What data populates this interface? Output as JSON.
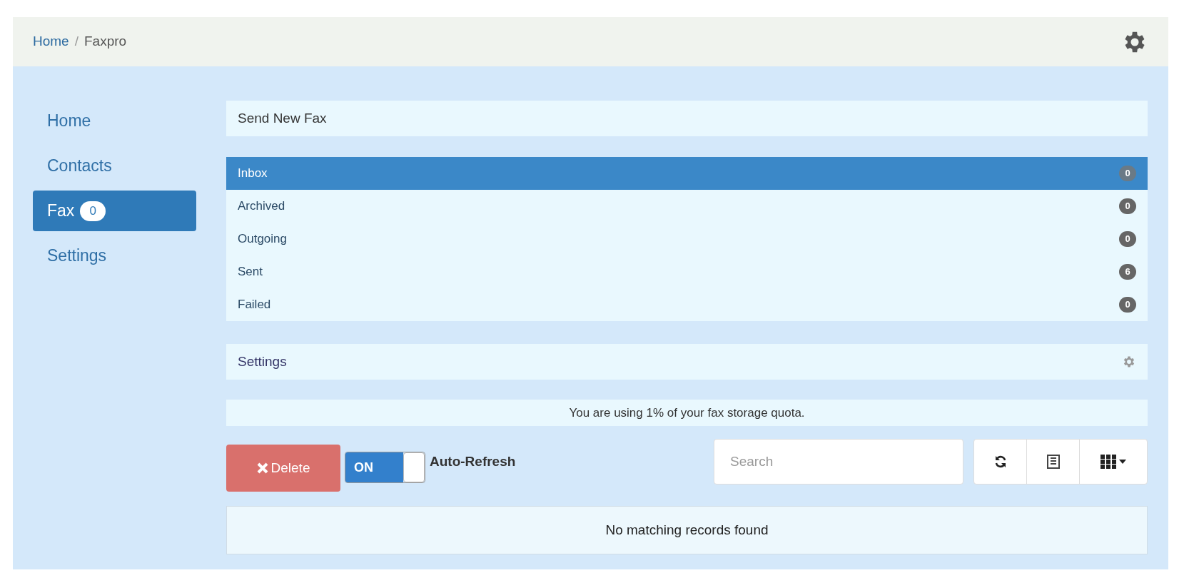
{
  "breadcrumb": {
    "items": [
      "Home",
      "Faxpro"
    ],
    "separator": "/"
  },
  "sidebar": {
    "items": [
      {
        "label": "Home",
        "selected": false
      },
      {
        "label": "Contacts",
        "selected": false
      },
      {
        "label": "Fax",
        "badge": "0",
        "selected": true
      },
      {
        "label": "Settings",
        "selected": false
      }
    ]
  },
  "send_panel": {
    "title": "Send New Fax"
  },
  "folders": [
    {
      "label": "Inbox",
      "count": "0",
      "selected": true
    },
    {
      "label": "Archived",
      "count": "0",
      "selected": false
    },
    {
      "label": "Outgoing",
      "count": "0",
      "selected": false
    },
    {
      "label": "Sent",
      "count": "6",
      "selected": false
    },
    {
      "label": "Failed",
      "count": "0",
      "selected": false
    }
  ],
  "settings_panel": {
    "title": "Settings"
  },
  "quota": "You are using 1% of your fax storage quota.",
  "toolbar": {
    "delete": "Delete",
    "toggle": {
      "label": "ON",
      "on": true
    },
    "toggle_label": "Auto-Refresh",
    "search": {
      "placeholder": "Search"
    }
  },
  "empty_message": "No matching records found"
}
